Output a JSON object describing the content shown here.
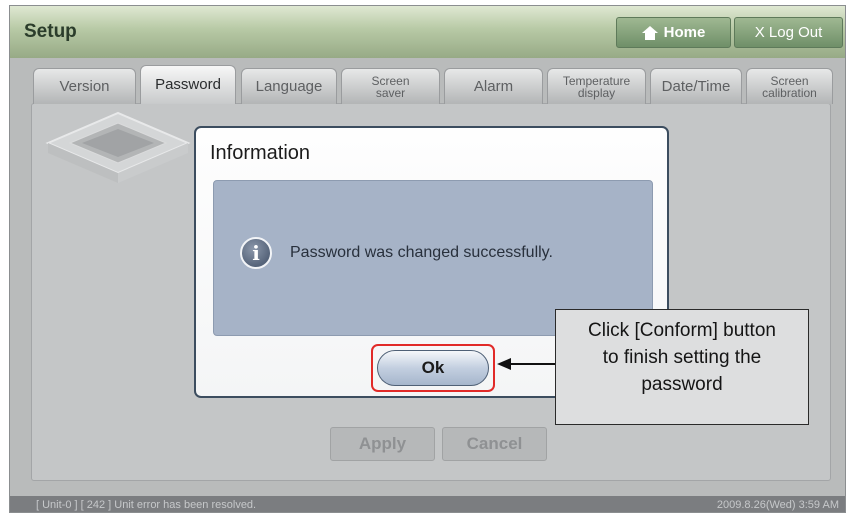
{
  "window": {
    "title": "Setup"
  },
  "header": {
    "home_label": "Home",
    "logout_label": "X Log Out"
  },
  "tabs": [
    {
      "label": "Version"
    },
    {
      "label": "Password",
      "active": true
    },
    {
      "label": "Language"
    },
    {
      "label_line1": "Screen",
      "label_line2": "saver"
    },
    {
      "label": "Alarm"
    },
    {
      "label_line1": "Temperature",
      "label_line2": "display"
    },
    {
      "label": "Date/Time"
    },
    {
      "label_line1": "Screen",
      "label_line2": "calibration"
    }
  ],
  "actions": {
    "apply_label": "Apply",
    "cancel_label": "Cancel"
  },
  "status_bar": {
    "message": "[ Unit-0 ] [ 242 ] Unit error has been resolved.",
    "datetime": "2009.8.26(Wed)  3:59 AM"
  },
  "dialog": {
    "title": "Information",
    "icon": "info-icon",
    "message": "Password was changed successfully.",
    "ok_label": "Ok"
  },
  "callout": {
    "line1": "Click [Conform] button",
    "line2": "to finish setting the",
    "line3": "password"
  },
  "colors": {
    "highlight": "#e12a28",
    "title_bar": "#b7c9a5",
    "dialog_body": "#a6b3c7"
  }
}
